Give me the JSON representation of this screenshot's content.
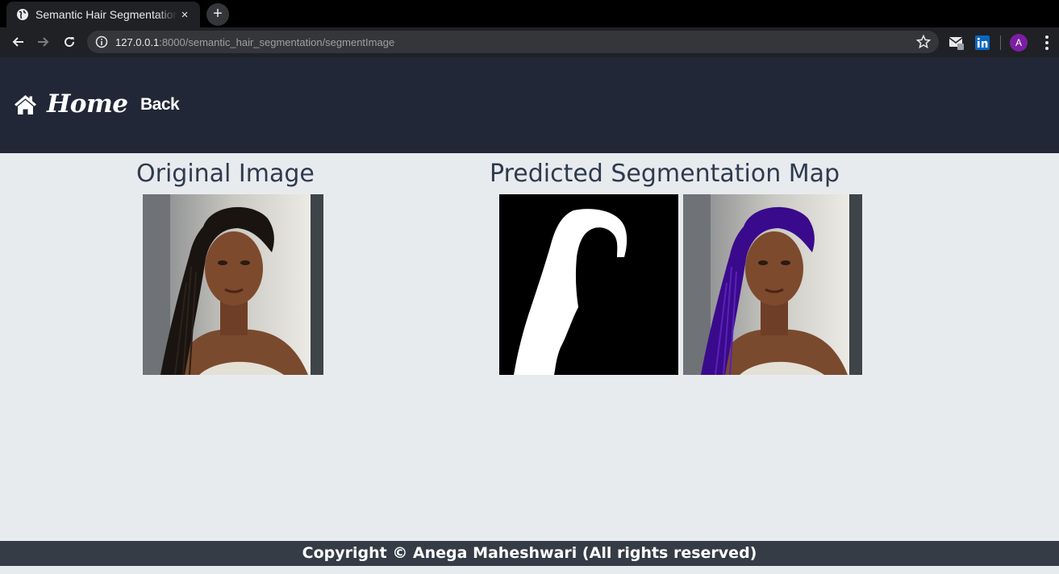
{
  "browser": {
    "tab_title": "Semantic Hair Segmentation",
    "tab_close": "×",
    "new_tab": "+",
    "url_host": "127.0.0.1",
    "url_path": ":8000/semantic_hair_segmentation/segmentImage",
    "profile_initial": "A"
  },
  "navbar": {
    "home_label": "Home",
    "back_label": "Back"
  },
  "main": {
    "original_heading": "Original Image",
    "predicted_heading": "Predicted Segmentation Map"
  },
  "footer": {
    "text": "Copyright © Anega Maheshwari (All rights reserved)"
  },
  "colors": {
    "navbar_bg": "#212736",
    "page_bg": "#e8ebee",
    "heading_text": "#2e3b4f",
    "footer_bg": "#353c46",
    "hair_overlay": "#3a0a8c"
  }
}
